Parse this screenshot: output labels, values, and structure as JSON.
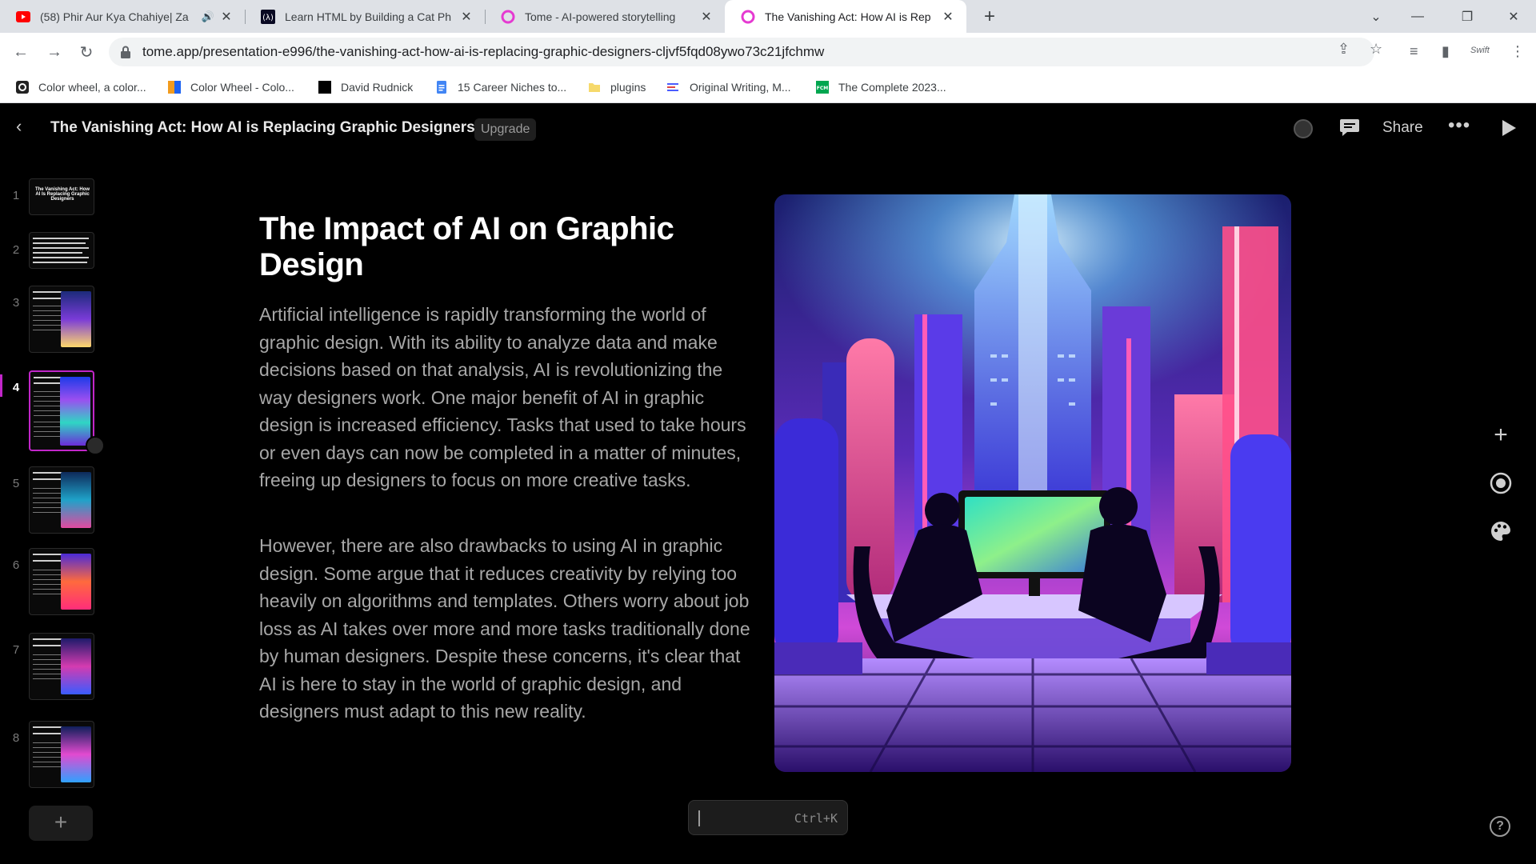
{
  "browser": {
    "tabs": [
      {
        "title": "(58) Phir Aur Kya Chahiye| Za",
        "favicon": "youtube-icon",
        "audio": true
      },
      {
        "title": "Learn HTML by Building a Cat Ph",
        "favicon": "freecodecamp-icon"
      },
      {
        "title": "Tome - AI-powered storytelling",
        "favicon": "tome-icon"
      },
      {
        "title": "The Vanishing Act: How AI is Rep",
        "favicon": "tome-icon",
        "active": true
      }
    ],
    "url": "tome.app/presentation-e996/the-vanishing-act-how-ai-is-replacing-graphic-designers-cljvf5fqd08ywo73c21jfchmw",
    "bookmarks": [
      {
        "label": "Color wheel, a color...",
        "icon": "color-wheel-icon"
      },
      {
        "label": "Color Wheel - Colo...",
        "icon": "canva-icon"
      },
      {
        "label": "David Rudnick",
        "icon": "black-square-icon"
      },
      {
        "label": "15 Career Niches to...",
        "icon": "google-docs-icon"
      },
      {
        "label": "plugins",
        "icon": "folder-icon"
      },
      {
        "label": "Original Writing, M...",
        "icon": "lines-icon"
      },
      {
        "label": "The Complete 2023...",
        "icon": "fcm-icon"
      }
    ],
    "ext_label": "Swift"
  },
  "header": {
    "title": "The Vanishing Act: How AI is Replacing Graphic Designers",
    "upgrade_label": "Upgrade",
    "share_label": "Share"
  },
  "slides": {
    "numbers": [
      "1",
      "2",
      "3",
      "4",
      "5",
      "6",
      "7",
      "8"
    ],
    "active": "4",
    "thumb1_text": "The Vanishing Act: How AI Is Replacing Graphic Designers"
  },
  "slide": {
    "title": "The Impact of AI on Graphic Design",
    "paragraphs": [
      "Artificial intelligence is rapidly transforming the world of graphic design. With its ability to analyze data and make decisions based on that analysis, AI is revolutionizing the way designers work. One major benefit of AI in graphic design is increased efficiency. Tasks that used to take hours or even days can now be completed in a matter of minutes, freeing up designers to focus on more creative tasks.",
      "However, there are also drawbacks to using AI in graphic design. Some argue that it reduces creativity by relying too heavily on algorithms and templates. Others worry about job loss as AI takes over more and more tasks traditionally done by human designers. Despite these concerns, it's clear that AI is here to stay in the world of graphic design, and designers must adapt to this new reality."
    ]
  },
  "command_bar": {
    "shortcut": "Ctrl+K"
  },
  "colors": {
    "accent": "#c126c9",
    "background": "#000000",
    "text_muted": "#a7a7a7"
  }
}
